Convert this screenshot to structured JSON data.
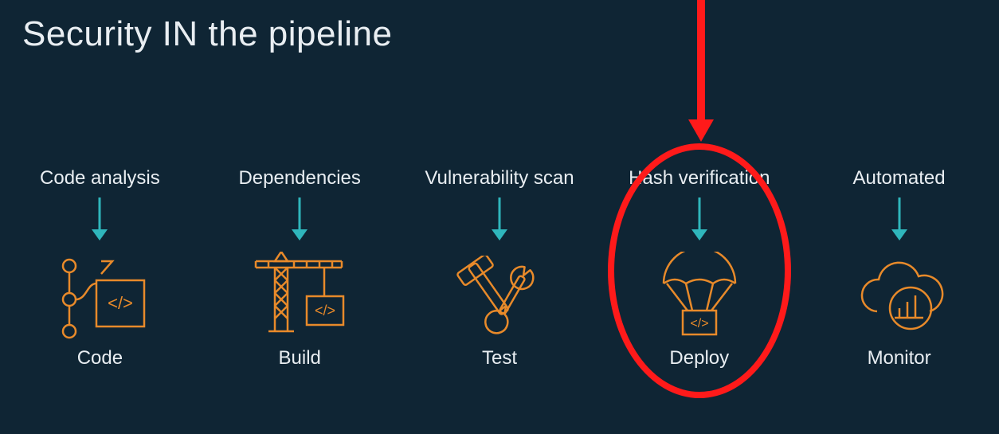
{
  "title": "Security IN the pipeline",
  "stages": [
    {
      "activity": "Code analysis",
      "label": "Code",
      "icon": "code-graph",
      "highlight": false
    },
    {
      "activity": "Dependencies",
      "label": "Build",
      "icon": "crane-code",
      "highlight": false
    },
    {
      "activity": "Vulnerability scan",
      "label": "Test",
      "icon": "tools",
      "highlight": false
    },
    {
      "activity": "Hash verification",
      "label": "Deploy",
      "icon": "parachute-code",
      "highlight": true
    },
    {
      "activity": "Automated",
      "label": "Monitor",
      "icon": "cloud-chart",
      "highlight": false
    }
  ],
  "colors": {
    "background": "#0f2534",
    "accent_orange": "#e88a2a",
    "accent_teal": "#2fb6bc",
    "highlight_red": "#ff1a1a",
    "text": "#e9eef2"
  }
}
